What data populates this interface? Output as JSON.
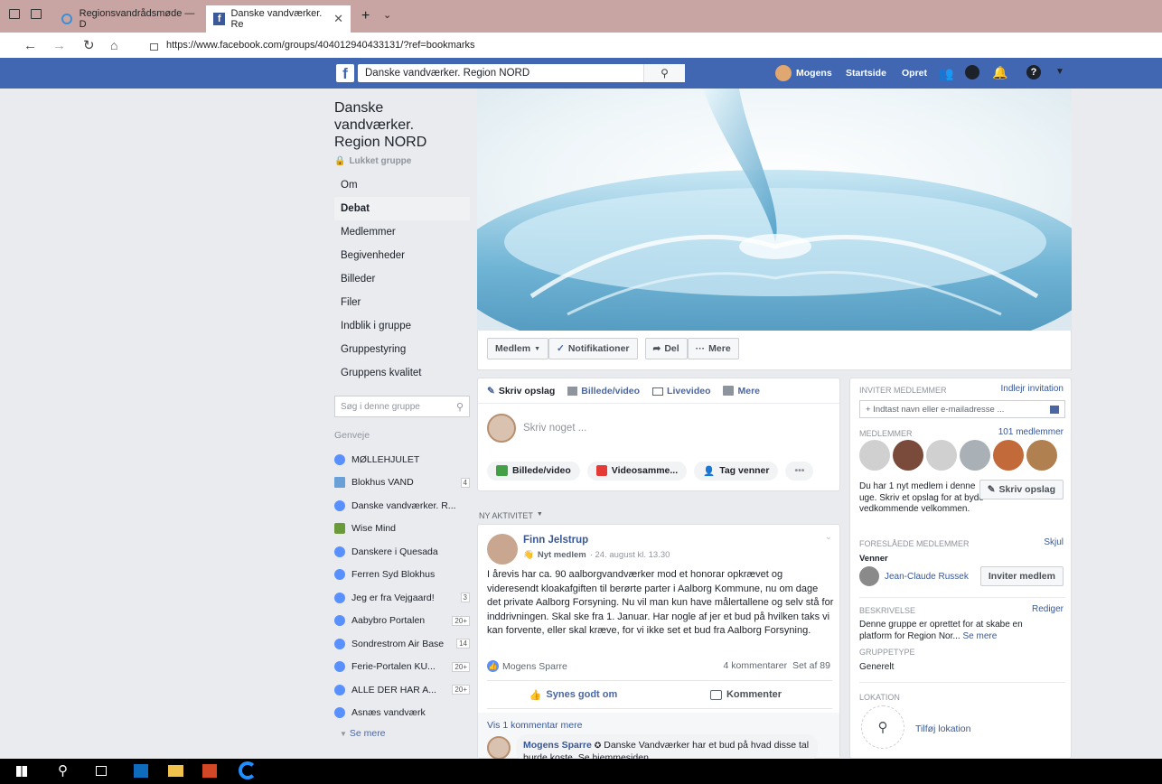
{
  "browser": {
    "tabs": [
      {
        "label": "Regionsvandrådsmøde — D"
      },
      {
        "label": "Danske vandværker. Re"
      }
    ],
    "url": "https://www.facebook.com/groups/404012940433131/?ref=bookmarks"
  },
  "fb_bar": {
    "search_value": "Danske vandværker. Region NORD",
    "user_name": "Mogens",
    "home_label": "Startside",
    "create_label": "Opret"
  },
  "group": {
    "name": "Danske vandværker. Region NORD",
    "privacy": "Lukket gruppe",
    "nav": [
      "Om",
      "Debat",
      "Medlemmer",
      "Begivenheder",
      "Billeder",
      "Filer",
      "Indblik i gruppe",
      "Gruppestyring",
      "Gruppens kvalitet"
    ],
    "search_placeholder": "Søg i denne gruppe",
    "shortcuts_heading": "Genveje",
    "shortcuts": [
      {
        "label": "MØLLEHJULET",
        "badge": ""
      },
      {
        "label": "Blokhus VAND",
        "badge": "4"
      },
      {
        "label": "Danske vandværker. R...",
        "badge": ""
      },
      {
        "label": "Wise Mind",
        "badge": ""
      },
      {
        "label": "Danskere i Quesada",
        "badge": ""
      },
      {
        "label": "Ferren Syd Blokhus",
        "badge": ""
      },
      {
        "label": "Jeg er fra Vejgaard!",
        "badge": "3"
      },
      {
        "label": "Aabybro Portalen",
        "badge": "20+"
      },
      {
        "label": "Sondrestrom Air Base",
        "badge": "14"
      },
      {
        "label": "Ferie-Portalen KU...",
        "badge": "20+"
      },
      {
        "label": "ALLE DER HAR A...",
        "badge": "20+"
      },
      {
        "label": "Asnæs vandværk",
        "badge": ""
      }
    ],
    "see_more": "Se mere"
  },
  "actions": {
    "member": "Medlem",
    "notifications": "Notifikationer",
    "share": "Del",
    "more": "Mere"
  },
  "composer": {
    "tabs": [
      "Skriv opslag",
      "Billede/video",
      "Livevideo",
      "Mere"
    ],
    "placeholder": "Skriv noget ...",
    "options": [
      "Billede/video",
      "Videosamme...",
      "Tag venner"
    ],
    "dots": "•••"
  },
  "activity_label": "NY AKTIVITET",
  "post": {
    "author": "Finn Jelstrup",
    "meta_badge": "Nyt medlem",
    "meta_date": "· 24. august kl. 13.30",
    "text": "I årevis har ca. 90 aalborgvandværker mod et honorar opkrævet og videresendt kloakafgiften til berørte parter i Aalborg Kommune, nu om dage det private Aalborg Forsyning. Nu vil man kun have målertallene og selv stå for inddrivningen. Skal ske fra 1. Januar. Har nogle af jer et bud på hvilken taks vi kan forvente, eller skal kræve, for vi ikke set et bud fra Aalborg Forsyning.",
    "liker": "Mogens Sparre",
    "stats": "4 kommentarer  Set af 89",
    "like_label": "Synes godt om",
    "comment_label": "Kommenter",
    "view_more": "Vis 1 kommentar mere",
    "comment_author": "Mogens Sparre",
    "comment_text": "Danske Vandværker har et bud på hvad disse tal burde koste. Se hjemmesiden"
  },
  "sidebar": {
    "invite_heading": "INVITER MEDLEMMER",
    "invite_link": "Indlejr invitation",
    "invite_placeholder": "+ Indtast navn eller e-mailadresse ...",
    "members_heading": "MEDLEMMER",
    "members_count": "101 medlemmer",
    "new_member_text": "Du har 1 nyt medlem i denne uge. Skriv et opslag for at byde vedkommende velkommen.",
    "write_post": "Skriv opslag",
    "suggested_heading": "FORESLÅEDE MEDLEMMER",
    "hide": "Skjul",
    "friends_label": "Venner",
    "suggested_name": "Jean-Claude Russek",
    "invite_member": "Inviter medlem",
    "desc_heading": "BESKRIVELSE",
    "edit": "Rediger",
    "desc_text": "Denne gruppe er oprettet for at skabe en platform for Region Nor...",
    "desc_more": "Se mere",
    "type_heading": "GRUPPETYPE",
    "type_value": "Generelt",
    "location_heading": "LOKATION",
    "add_location": "Tilføj lokation"
  },
  "colors": {
    "fb_blue": "#4267b2",
    "link": "#385898",
    "tabbar": "#c8a5a3"
  }
}
